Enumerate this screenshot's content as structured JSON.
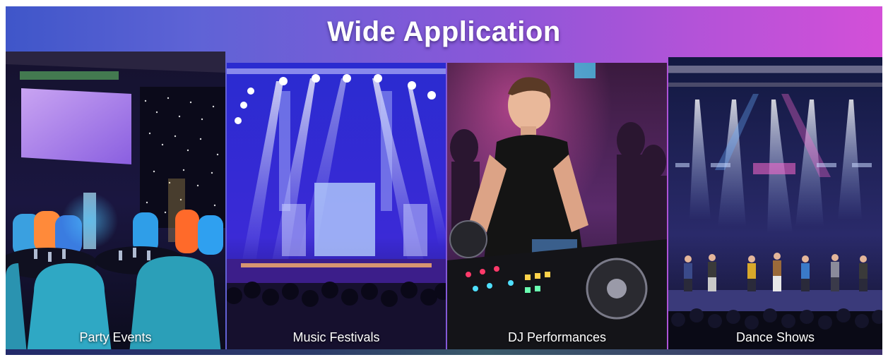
{
  "page": {
    "title": "Wide Application"
  },
  "applications": [
    {
      "label": "Party Events",
      "scene": "banquet-hall-scene"
    },
    {
      "label": "Music Festivals",
      "scene": "concert-stage-scene"
    },
    {
      "label": "DJ Performances",
      "scene": "dj-booth-scene"
    },
    {
      "label": "Dance Shows",
      "scene": "dance-stage-scene"
    }
  ],
  "colors": {
    "banner_start": "#3f56c9",
    "banner_end": "#d34fd8",
    "label_text": "#ffffff"
  }
}
